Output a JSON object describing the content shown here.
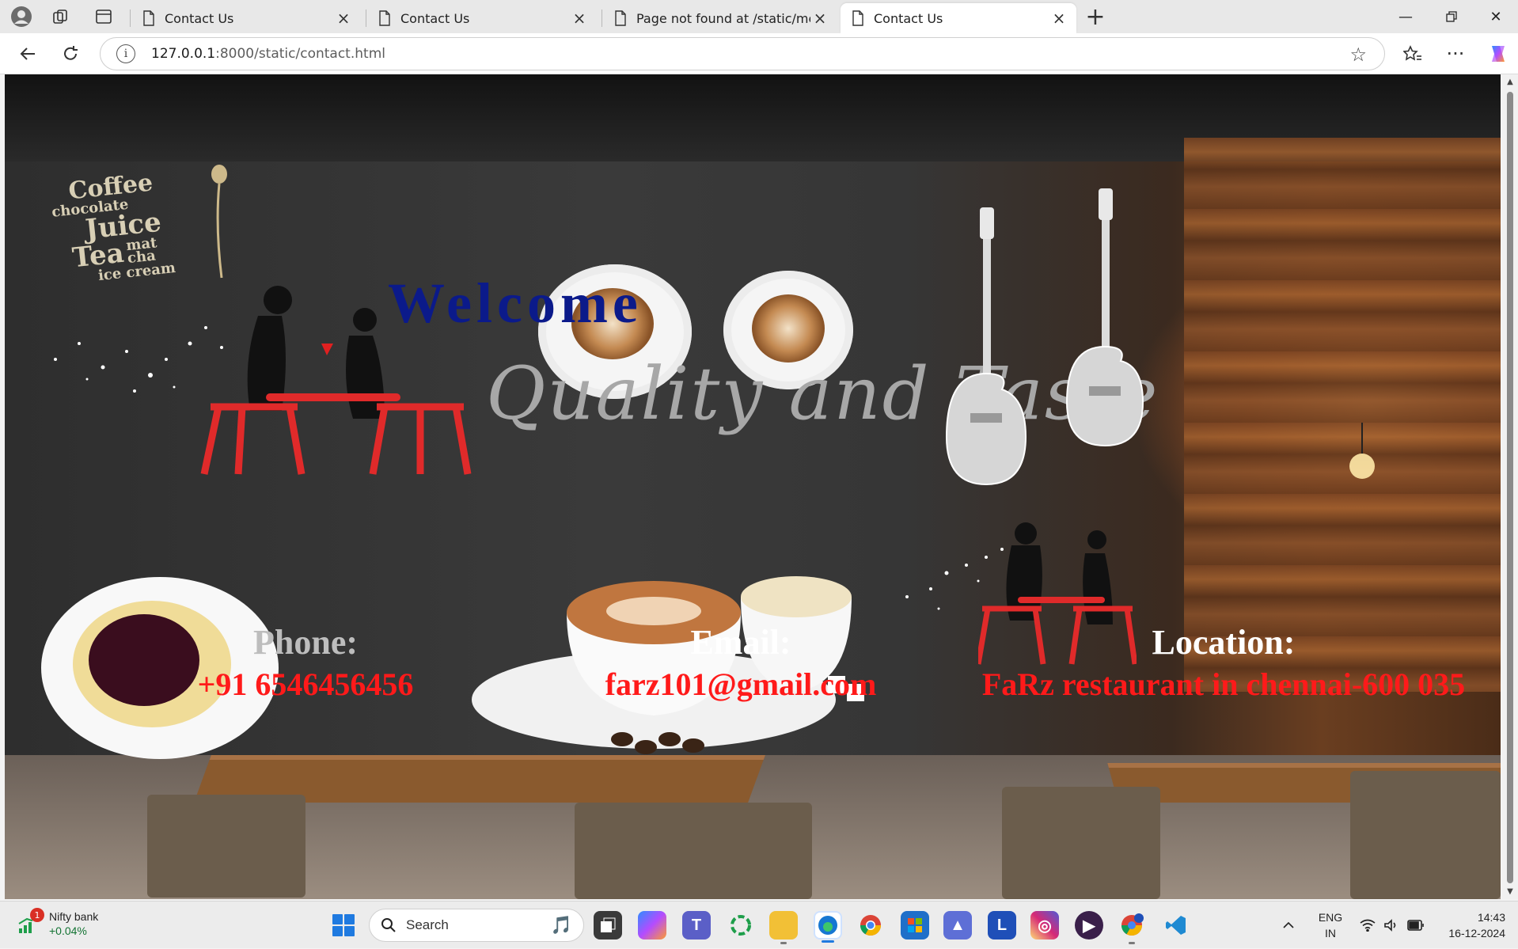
{
  "browser": {
    "tabs": [
      {
        "title": "Contact Us",
        "active": false
      },
      {
        "title": "Contact Us",
        "active": false
      },
      {
        "title": "Page not found at /static/menu.ht",
        "active": false
      },
      {
        "title": "Contact Us",
        "active": true
      }
    ],
    "url_host": "127.0.0.1",
    "url_rest": ":8000/static/contact.html"
  },
  "page": {
    "welcome": "Welcome",
    "background_text": {
      "menu_words": [
        "Coffee",
        "chocolate",
        "Juice",
        "Tea",
        "mat",
        "cha",
        "ice cream"
      ],
      "tagline": "Quality and Taste"
    },
    "contact": {
      "phone_label": "Phone:",
      "phone_value": "+91 6546456456",
      "email_label": "Email:",
      "email_value": "farz101@gmail.com",
      "location_label": "Location:",
      "location_value": "FaRz restaurant in chennai-600 035"
    },
    "colors": {
      "welcome": "#0b1a8a",
      "contact_value": "#ff1a1a",
      "contact_label": "#ffffff"
    }
  },
  "taskbar": {
    "widget_name": "Nifty bank",
    "widget_change": "+0.04%",
    "widget_badge": "1",
    "search_label": "Search",
    "language_line1": "ENG",
    "language_line2": "IN",
    "time": "14:43",
    "date": "16-12-2024",
    "apps": [
      "start-icon",
      "search-icon",
      "task-view-icon",
      "copilot-icon",
      "teams-icon",
      "sync-icon",
      "file-explorer-icon",
      "edge-icon",
      "chrome-icon",
      "store-icon",
      "vpn-icon",
      "l-app-icon",
      "instagram-icon",
      "media-player-icon",
      "chrome-profile-icon",
      "vscode-icon"
    ]
  }
}
